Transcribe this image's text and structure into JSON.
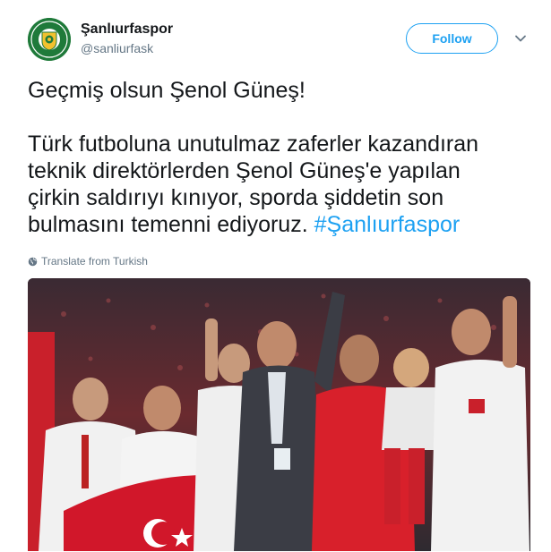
{
  "account": {
    "name": "Şanlıurfaspor",
    "handle": "@sanliurfask"
  },
  "actions": {
    "follow_label": "Follow"
  },
  "tweet": {
    "line1": "Geçmiş olsun Şenol Güneş!",
    "body_lines": [
      "Türk futboluna unutulmaz zaferler kazandıran",
      "teknik direktörlerden Şenol Güneş'e yapılan",
      "çirkin saldırıyı kınıyor, sporda şiddetin son",
      "bulmasını temenni ediyoruz."
    ],
    "hashtag": "#Şanlıurfaspor",
    "translate_label": "Translate from Turkish"
  },
  "icons": {
    "avatar": "club-logo-icon",
    "menu": "chevron-down-icon",
    "translate": "globe-icon"
  },
  "colors": {
    "accent": "#1da1f2",
    "text": "#14171a",
    "muted": "#657786",
    "logo_green": "#1f7a3a",
    "logo_yellow": "#f2c12e"
  }
}
